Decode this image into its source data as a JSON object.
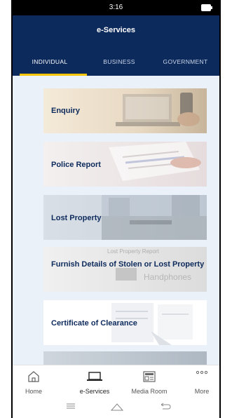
{
  "status_bar": {
    "time": "3:16"
  },
  "app_bar": {
    "title": "e-Services"
  },
  "tabs": [
    {
      "label": "INDIVIDUAL",
      "active": true
    },
    {
      "label": "BUSINESS",
      "active": false
    },
    {
      "label": "GOVERNMENT",
      "active": false
    }
  ],
  "services": [
    {
      "label": "Enquiry"
    },
    {
      "label": "Police Report"
    },
    {
      "label": "Lost Property"
    },
    {
      "label": "Furnish Details of Stolen or Lost Property"
    },
    {
      "label": "Certificate of Clearance"
    },
    {
      "label": ""
    }
  ],
  "card_art": {
    "lost_property_report_text": "Lost Property Report",
    "handphones_text": "Handphones"
  },
  "bottom_nav": [
    {
      "label": "Home",
      "icon": "home-icon",
      "active": false
    },
    {
      "label": "e-Services",
      "icon": "laptop-icon",
      "active": true
    },
    {
      "label": "Media Room",
      "icon": "newspaper-icon",
      "active": false
    },
    {
      "label": "More",
      "icon": "more-icon",
      "active": false
    }
  ],
  "colors": {
    "primary": "#0d2a5c",
    "accent": "#f5c400",
    "content_bg": "#eaf1f8"
  }
}
